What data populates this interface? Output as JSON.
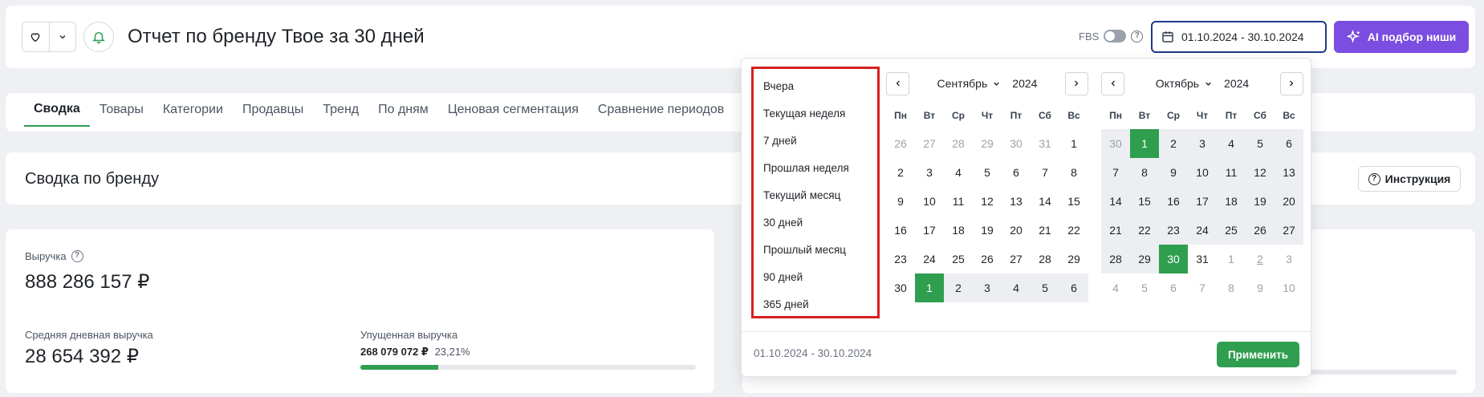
{
  "header": {
    "title": "Отчет по бренду Твое за 30 дней",
    "fbs_label": "FBS",
    "fbs_enabled": false,
    "date_range": "01.10.2024 - 30.10.2024",
    "ai_button": "AI подбор ниши"
  },
  "tabs": [
    "Сводка",
    "Товары",
    "Категории",
    "Продавцы",
    "Тренд",
    "По дням",
    "Ценовая сегментация",
    "Сравнение периодов"
  ],
  "active_tab": "Сводка",
  "summary": {
    "title": "Сводка по бренду",
    "instruction_button": "Инструкция"
  },
  "metrics": {
    "revenue_label": "Выручка",
    "revenue_value": "888 286 157 ₽",
    "avg_label": "Средняя дневная выручка",
    "avg_value": "28 654 392 ₽",
    "lost_label": "Упущенная выручка",
    "lost_value": "268 079 072 ₽",
    "lost_percent": "23,21%",
    "lost_progress": 0.2321
  },
  "picker": {
    "presets": [
      "Вчера",
      "Текущая неделя",
      "7 дней",
      "Прошлая неделя",
      "Текущий месяц",
      "30 дней",
      "Прошлый месяц",
      "90 дней",
      "365 дней"
    ],
    "weekdays": [
      "Пн",
      "Вт",
      "Ср",
      "Чт",
      "Пт",
      "Сб",
      "Вс"
    ],
    "left": {
      "month": "Сентябрь",
      "year": "2024",
      "days": [
        {
          "d": "26",
          "o": true
        },
        {
          "d": "27",
          "o": true
        },
        {
          "d": "28",
          "o": true
        },
        {
          "d": "29",
          "o": true
        },
        {
          "d": "30",
          "o": true
        },
        {
          "d": "31",
          "o": true
        },
        {
          "d": "1"
        },
        {
          "d": "2"
        },
        {
          "d": "3"
        },
        {
          "d": "4"
        },
        {
          "d": "5"
        },
        {
          "d": "6"
        },
        {
          "d": "7"
        },
        {
          "d": "8"
        },
        {
          "d": "9"
        },
        {
          "d": "10"
        },
        {
          "d": "11"
        },
        {
          "d": "12"
        },
        {
          "d": "13"
        },
        {
          "d": "14"
        },
        {
          "d": "15"
        },
        {
          "d": "16"
        },
        {
          "d": "17"
        },
        {
          "d": "18"
        },
        {
          "d": "19"
        },
        {
          "d": "20"
        },
        {
          "d": "21"
        },
        {
          "d": "22"
        },
        {
          "d": "23"
        },
        {
          "d": "24"
        },
        {
          "d": "25"
        },
        {
          "d": "26"
        },
        {
          "d": "27"
        },
        {
          "d": "28"
        },
        {
          "d": "29"
        },
        {
          "d": "30"
        },
        {
          "d": "1",
          "s": true
        },
        {
          "d": "2",
          "r": true
        },
        {
          "d": "3",
          "r": true
        },
        {
          "d": "4",
          "r": true
        },
        {
          "d": "5",
          "r": true
        },
        {
          "d": "6",
          "r": true
        }
      ]
    },
    "right": {
      "month": "Октябрь",
      "year": "2024",
      "days": [
        {
          "d": "30",
          "o": true,
          "r": true
        },
        {
          "d": "1",
          "s": true
        },
        {
          "d": "2",
          "r": true
        },
        {
          "d": "3",
          "r": true
        },
        {
          "d": "4",
          "r": true
        },
        {
          "d": "5",
          "r": true
        },
        {
          "d": "6",
          "r": true
        },
        {
          "d": "7",
          "r": true
        },
        {
          "d": "8",
          "r": true
        },
        {
          "d": "9",
          "r": true
        },
        {
          "d": "10",
          "r": true
        },
        {
          "d": "11",
          "r": true
        },
        {
          "d": "12",
          "r": true
        },
        {
          "d": "13",
          "r": true
        },
        {
          "d": "14",
          "r": true
        },
        {
          "d": "15",
          "r": true
        },
        {
          "d": "16",
          "r": true
        },
        {
          "d": "17",
          "r": true
        },
        {
          "d": "18",
          "r": true
        },
        {
          "d": "19",
          "r": true
        },
        {
          "d": "20",
          "r": true
        },
        {
          "d": "21",
          "r": true
        },
        {
          "d": "22",
          "r": true
        },
        {
          "d": "23",
          "r": true
        },
        {
          "d": "24",
          "r": true
        },
        {
          "d": "25",
          "r": true
        },
        {
          "d": "26",
          "r": true
        },
        {
          "d": "27",
          "r": true
        },
        {
          "d": "28",
          "r": true
        },
        {
          "d": "29",
          "r": true
        },
        {
          "d": "30",
          "s": true
        },
        {
          "d": "31"
        },
        {
          "d": "1",
          "o": true
        },
        {
          "d": "2",
          "o": true,
          "u": true
        },
        {
          "d": "3",
          "o": true
        },
        {
          "d": "4",
          "o": true
        },
        {
          "d": "5",
          "o": true
        },
        {
          "d": "6",
          "o": true
        },
        {
          "d": "7",
          "o": true
        },
        {
          "d": "8",
          "o": true
        },
        {
          "d": "9",
          "o": true
        },
        {
          "d": "10",
          "o": true
        }
      ]
    },
    "footer_range": "01.10.2024 - 30.10.2024",
    "apply_button": "Применить"
  },
  "colors": {
    "accent_green": "#2f9e4f",
    "ai_purple": "#7b4de0",
    "highlight_red": "#d71f1f"
  }
}
